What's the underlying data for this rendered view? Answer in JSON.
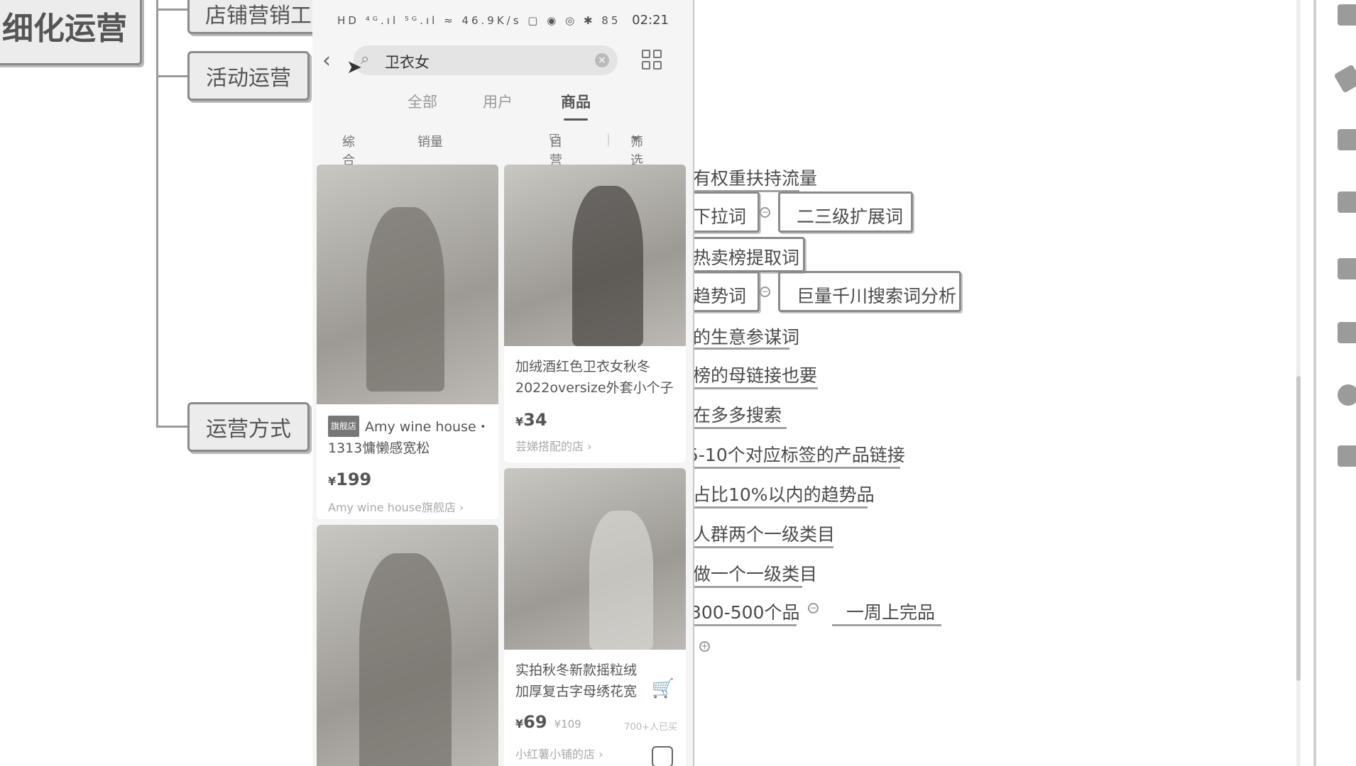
{
  "mindmap": {
    "root_fragment": "细化运营",
    "branches": [
      {
        "label": "店铺营销工"
      },
      {
        "label": "活动运营"
      },
      {
        "label": "运营方式"
      }
    ],
    "leaves": [
      "有权重扶持流量",
      "下拉词",
      "二三级扩展词",
      "热卖榜提取词",
      "趋势词",
      "巨量千川搜索词分析",
      "的生意参谋词",
      "榜的母链接也要",
      "在多多搜索",
      "5-10个对应标签的产品链接",
      "占比10%以内的趋势品",
      "人群两个一级类目",
      "做一个一级类目",
      "300-500个品",
      "一周上完品"
    ]
  },
  "phone": {
    "status": {
      "icons": "HD ⁴ᴳ.ıl ⁵ᴳ.ıl ≈ 46.9K/s ▢ ◉ ◎ ✱ 85",
      "time": "02:21"
    },
    "search": {
      "query": "卫衣女"
    },
    "tabs": [
      "全部",
      "用户",
      "商品"
    ],
    "active_tab": "商品",
    "filters": {
      "sort": "综合",
      "sales": "销量",
      "self_op": "自营",
      "filter": "筛选"
    },
    "products": [
      {
        "badge": "旗舰店",
        "title": "Amy wine house・1313慵懒感宽松",
        "price": "199",
        "shop": "Amy wine house旗舰店 ›"
      },
      {
        "title": "加绒酒红色卫衣女秋冬2022oversize外套小个子",
        "price": "34",
        "shop": "芸娣搭配的店 ›"
      },
      {
        "title": "实拍秋冬新款摇粒绒加厚复古字母绣花宽",
        "price": "69",
        "old_price": "¥109",
        "sold": "700+人已买",
        "shop": "小红薯小铺的店 ›"
      }
    ]
  },
  "colors": {
    "accent": "#555555",
    "background": "#ffffff"
  }
}
